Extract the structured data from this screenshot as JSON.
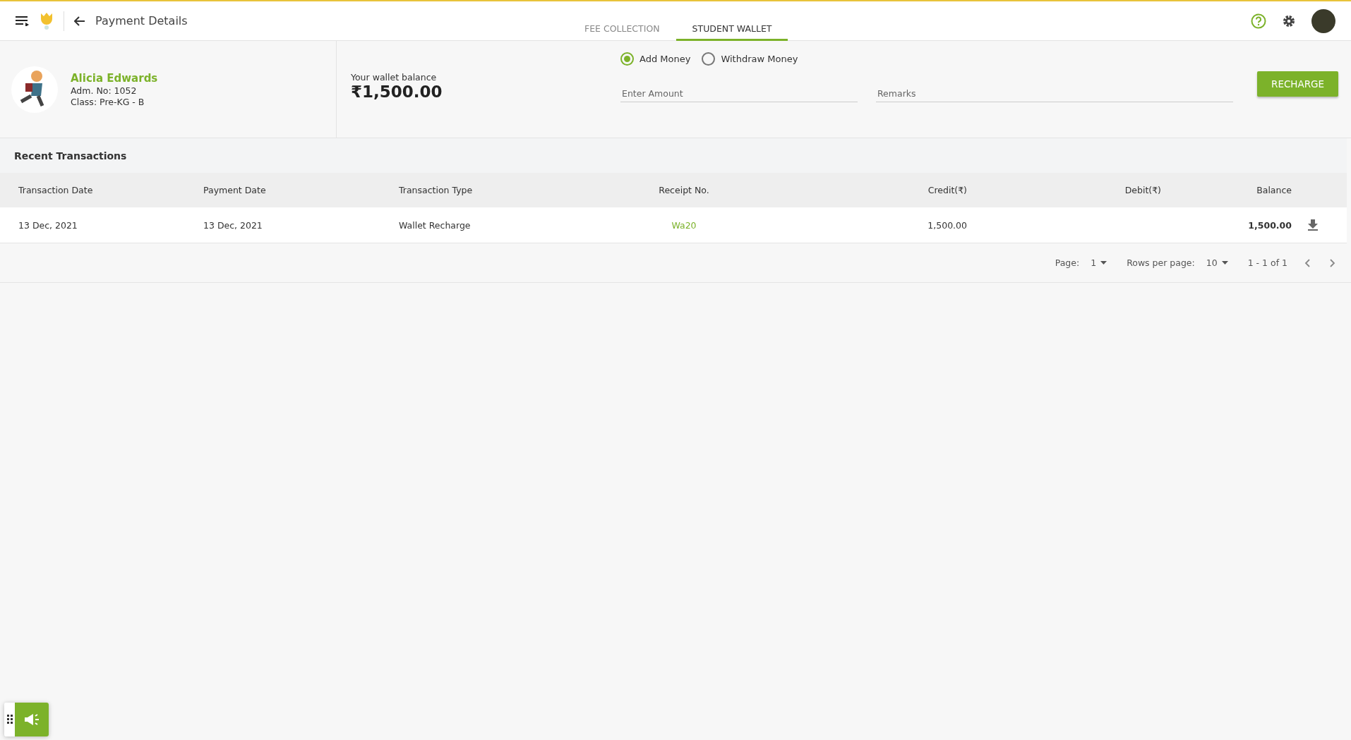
{
  "header": {
    "title": "Payment Details",
    "tabs": [
      {
        "label": "FEE COLLECTION",
        "selected": false
      },
      {
        "label": "STUDENT WALLET",
        "selected": true
      }
    ]
  },
  "student": {
    "name": "Alicia Edwards",
    "adm_no": "Adm. No: 1052",
    "class": "Class: Pre-KG - B"
  },
  "wallet": {
    "label": "Your wallet balance",
    "balance": "₹1,500.00"
  },
  "mode_options": [
    {
      "label": "Add Money",
      "selected": true
    },
    {
      "label": "Withdraw Money",
      "selected": false
    }
  ],
  "fields": [
    {
      "placeholder": "Enter Amount"
    },
    {
      "placeholder": "Remarks"
    }
  ],
  "recharge_button": "RECHARGE",
  "transactions": {
    "title": "Recent Transactions",
    "columns": [
      "Transaction Date",
      "Payment Date",
      "Transaction Type",
      "Receipt No.",
      "Credit(₹)",
      "Debit(₹)",
      "Balance"
    ],
    "rows": [
      {
        "transaction_date": "13 Dec, 2021",
        "payment_date": "13 Dec, 2021",
        "type": "Wallet Recharge",
        "receipt": "Wa20",
        "credit": "1,500.00",
        "debit": "",
        "balance": "1,500.00"
      }
    ]
  },
  "pagination": {
    "page_label": "Page:",
    "page": "1",
    "rows_label": "Rows per page:",
    "rows": "10",
    "range": "1 - 1 of 1"
  }
}
